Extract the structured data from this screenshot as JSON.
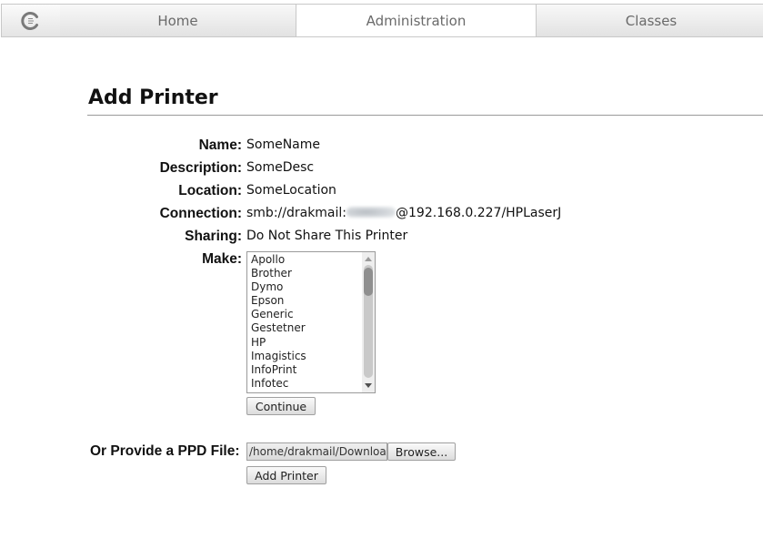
{
  "nav": {
    "logo_icon": "cups-logo-icon",
    "tabs": [
      {
        "label": "Home",
        "active": false
      },
      {
        "label": "Administration",
        "active": true
      },
      {
        "label": "Classes",
        "active": false
      }
    ]
  },
  "page": {
    "title": "Add Printer"
  },
  "form": {
    "name": {
      "label": "Name:",
      "value": "SomeName"
    },
    "description": {
      "label": "Description:",
      "value": "SomeDesc"
    },
    "location": {
      "label": "Location:",
      "value": "SomeLocation"
    },
    "connection": {
      "label": "Connection:",
      "prefix": "smb://drakmail:",
      "suffix": "@192.168.0.227/HPLaserJ"
    },
    "sharing": {
      "label": "Sharing:",
      "value": "Do Not Share This Printer"
    },
    "make": {
      "label": "Make:",
      "options": [
        "Apollo",
        "Brother",
        "Dymo",
        "Epson",
        "Generic",
        "Gestetner",
        "HP",
        "Imagistics",
        "InfoPrint",
        "Infotec"
      ],
      "scroll_position": 0.0
    },
    "continue_label": "Continue",
    "ppd": {
      "label": "Or Provide a PPD File:",
      "file_value": "/home/drakmail/Downloads",
      "browse_label": "Browse..."
    },
    "add_printer_label": "Add Printer"
  },
  "colors": {
    "text": "#111111",
    "nav_text": "#6a6a6a",
    "border": "#c8c8c8"
  }
}
